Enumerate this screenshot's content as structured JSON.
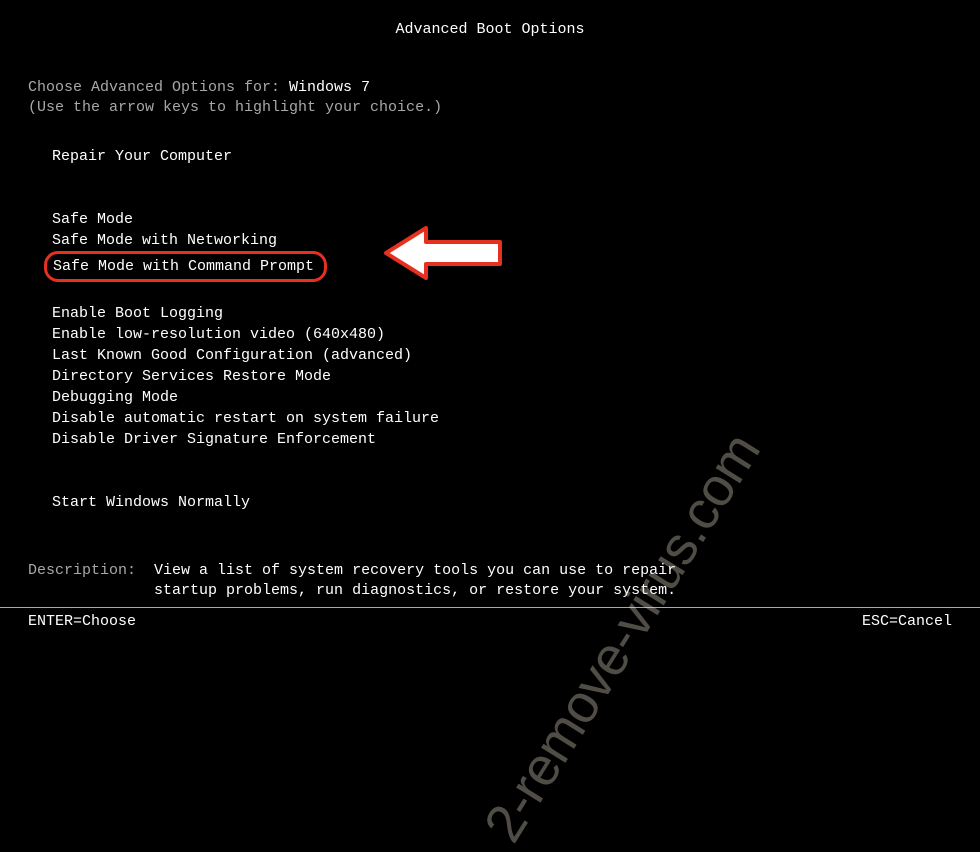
{
  "title": "Advanced Boot Options",
  "instructions": {
    "prefix": "Choose Advanced Options for: ",
    "osname": "Windows 7",
    "hint": "(Use the arrow keys to highlight your choice.)"
  },
  "groups": [
    {
      "items": [
        {
          "label": "Repair Your Computer",
          "highlighted": false
        }
      ]
    },
    {
      "items": [
        {
          "label": "Safe Mode",
          "highlighted": false
        },
        {
          "label": "Safe Mode with Networking",
          "highlighted": false
        },
        {
          "label": "Safe Mode with Command Prompt",
          "highlighted": true
        }
      ]
    },
    {
      "items": [
        {
          "label": "Enable Boot Logging",
          "highlighted": false
        },
        {
          "label": "Enable low-resolution video (640x480)",
          "highlighted": false
        },
        {
          "label": "Last Known Good Configuration (advanced)",
          "highlighted": false
        },
        {
          "label": "Directory Services Restore Mode",
          "highlighted": false
        },
        {
          "label": "Debugging Mode",
          "highlighted": false
        },
        {
          "label": "Disable automatic restart on system failure",
          "highlighted": false
        },
        {
          "label": "Disable Driver Signature Enforcement",
          "highlighted": false
        }
      ]
    },
    {
      "items": [
        {
          "label": "Start Windows Normally",
          "highlighted": false
        }
      ]
    }
  ],
  "description": {
    "label": "Description:",
    "text": "View a list of system recovery tools you can use to repair startup problems, run diagnostics, or restore your system."
  },
  "footer": {
    "left": "ENTER=Choose",
    "right": "ESC=Cancel"
  },
  "watermark": "2-remove-virus.com",
  "colors": {
    "highlight_border": "#e63020",
    "text_bright": "#ffffff",
    "text_dim": "#a8a8a8",
    "background": "#000000"
  }
}
